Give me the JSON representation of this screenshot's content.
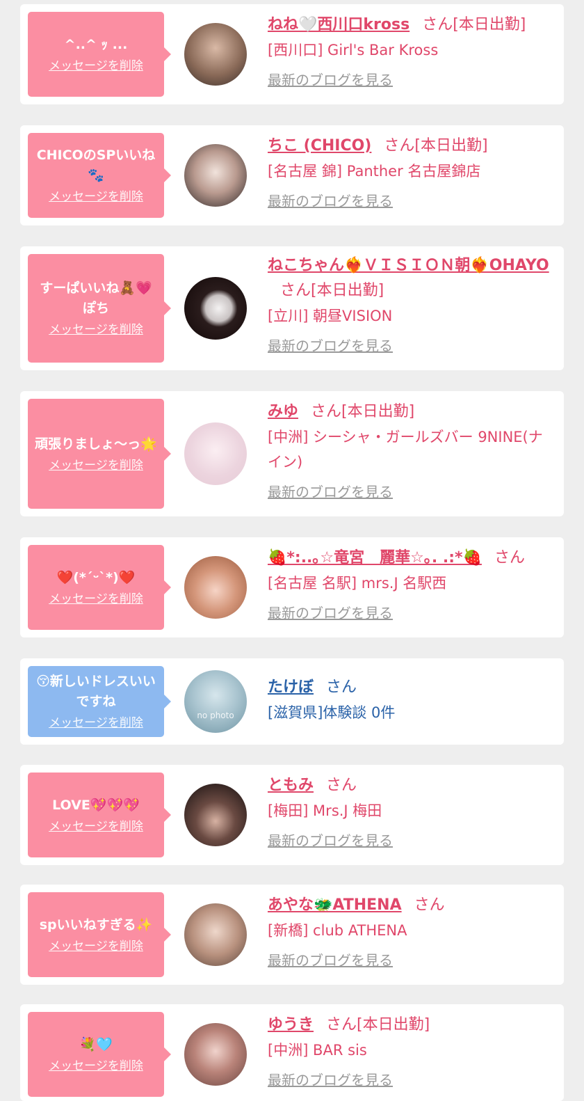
{
  "common": {
    "delete_label": "メッセージを削除",
    "blog_label": "最新のブログを見る",
    "san": "さん"
  },
  "cards": [
    {
      "message": "^..^ ｯ ...",
      "name": "ねね🤍西川口kross",
      "status": "[本日出勤]",
      "shop": "[西川口] Girl's Bar Kross",
      "blog": "最新のブログを見る"
    },
    {
      "message": "CHICOのSPいいね🐾",
      "name": "ちこ (CHICO)",
      "status": "[本日出勤]",
      "shop": "[名古屋 錦] Panther 名古屋錦店",
      "blog": "最新のブログを見る"
    },
    {
      "message": "すーぱいいね🧸💗ぽち",
      "name": "ねこちゃん❤️‍🔥ＶＩＳＩＯＮ朝❤️‍🔥OHAYO",
      "status": "[本日出勤]",
      "shop": "[立川] 朝昼VISION",
      "blog": "最新のブログを見る"
    },
    {
      "message": "頑張りましょ〜っ🌟",
      "name": "みゆ",
      "status": "[本日出勤]",
      "shop": "[中洲] シーシャ・ガールズバー 9NINE(ナイン)",
      "blog": "最新のブログを見る"
    },
    {
      "message": "❤️(*´ᵕ`*)❤️",
      "name": "🍓*:..｡☆竜宮　麗華☆｡. .:*🍓",
      "status": "",
      "shop": "[名古屋 名駅] mrs.J 名駅西",
      "blog": "最新のブログを見る"
    },
    {
      "message": "😚新しいドレスいいですね",
      "name": "たけぼ",
      "status": "",
      "shop": "[滋賀県]体験談 0件",
      "avatar_text": "no photo"
    },
    {
      "message": "LOVE💖💖💖",
      "name": "ともみ",
      "status": "",
      "shop": "[梅田] Mrs.J 梅田",
      "blog": "最新のブログを見る"
    },
    {
      "message": "spいいねすぎる✨",
      "name": "あやな🐲ATHENA",
      "status": "",
      "shop": "[新橋] club ATHENA",
      "blog": "最新のブログを見る"
    },
    {
      "message": "💐🩵",
      "name": "ゆうき",
      "status": "[本日出勤]",
      "shop": "[中洲] BAR sis",
      "blog": "最新のブログを見る"
    }
  ],
  "colors": {
    "accent_pink": "#e0476a",
    "bubble_pink": "#fb8ea2",
    "bubble_blue": "#8db9f0",
    "text_blue": "#2a62a8",
    "muted": "#9a9a9a"
  }
}
